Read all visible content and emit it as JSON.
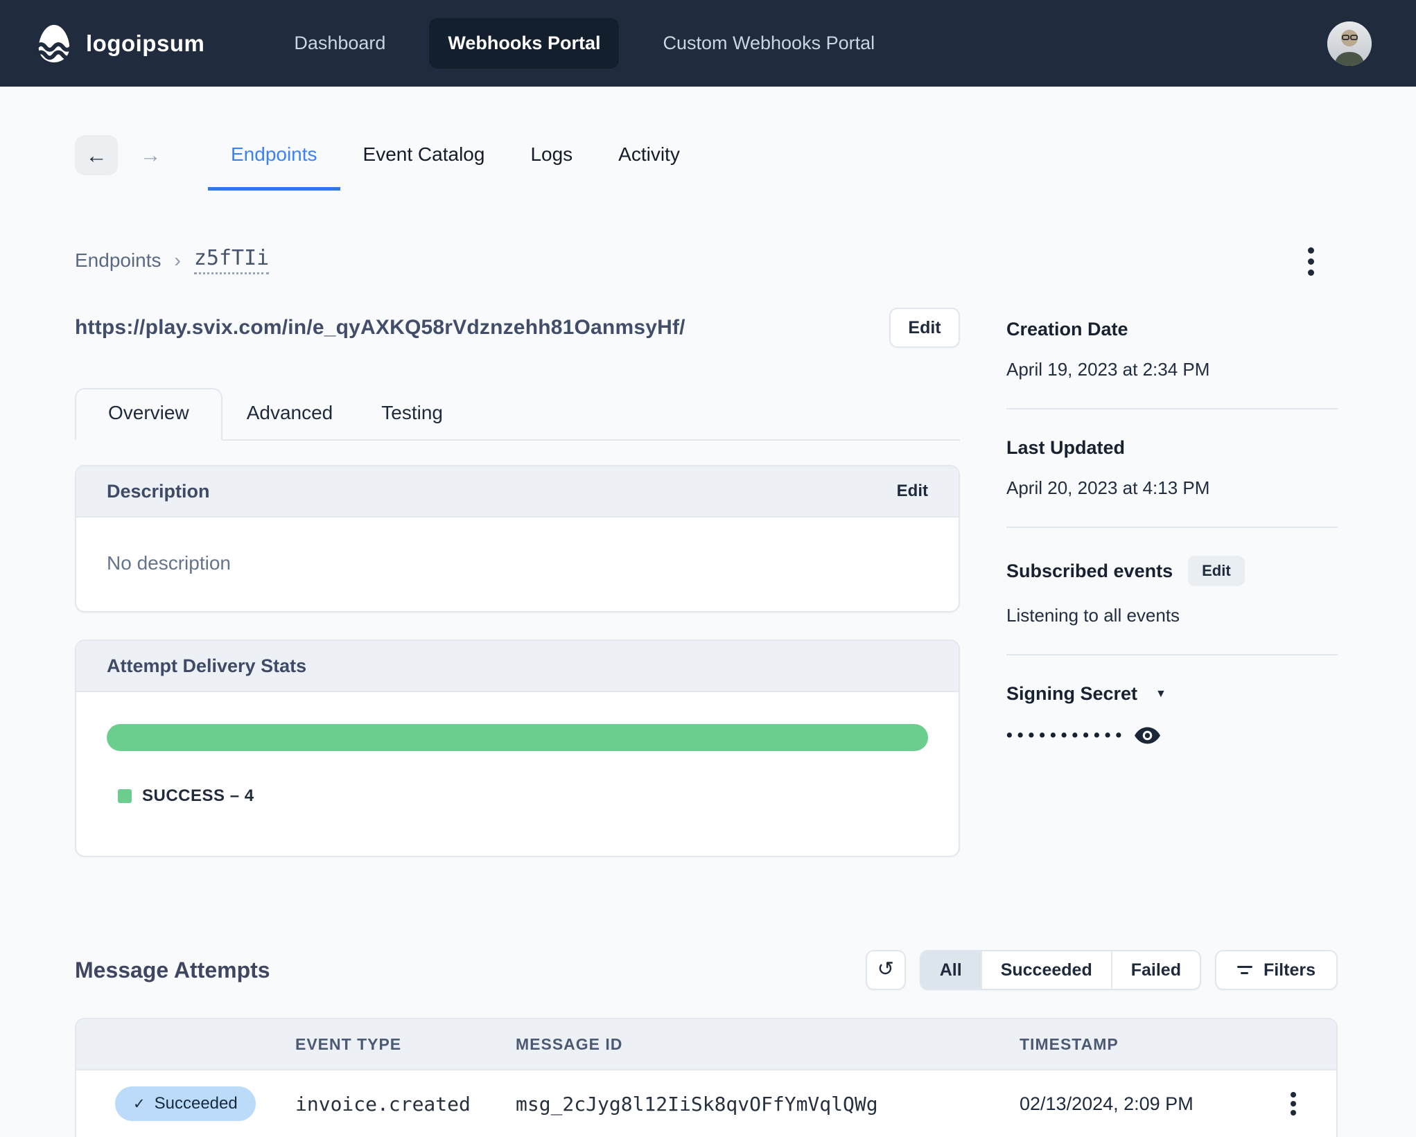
{
  "colors": {
    "nav_bg": "#202c3d",
    "accent_blue": "#3b82f6",
    "success_green": "#6cce8e",
    "badge_blue_bg": "#bcdbf9",
    "page_bg": "#f8fafc"
  },
  "icons": {
    "back_arrow": "←",
    "forward_arrow": "→",
    "breadcrumb_chevron": "›",
    "dropdown_caret": "▼",
    "refresh": "↺",
    "check": "✓"
  },
  "nav": {
    "logo_text": "logoipsum",
    "items": [
      {
        "label": "Dashboard",
        "active": false
      },
      {
        "label": "Webhooks Portal",
        "active": true
      },
      {
        "label": "Custom Webhooks Portal",
        "active": false
      }
    ]
  },
  "page_tabs": [
    {
      "label": "Endpoints",
      "active": true
    },
    {
      "label": "Event Catalog",
      "active": false
    },
    {
      "label": "Logs",
      "active": false
    },
    {
      "label": "Activity",
      "active": false
    }
  ],
  "breadcrumb": {
    "root": "Endpoints",
    "current": "z5fTIi"
  },
  "endpoint": {
    "url": "https://play.svix.com/in/e_qyAXKQ58rVdznzehh81OanmsyHf/",
    "edit_label": "Edit"
  },
  "detail_tabs": [
    {
      "label": "Overview",
      "active": true
    },
    {
      "label": "Advanced",
      "active": false
    },
    {
      "label": "Testing",
      "active": false
    }
  ],
  "description_card": {
    "title": "Description",
    "edit_label": "Edit",
    "empty_text": "No description"
  },
  "stats_card": {
    "title": "Attempt Delivery Stats",
    "legend_label": "SUCCESS – 4",
    "success_count": 4,
    "bar_percent": 100,
    "bar_color": "#6cce8e"
  },
  "sidebar": {
    "creation_date": {
      "label": "Creation Date",
      "value": "April 19, 2023 at 2:34 PM"
    },
    "last_updated": {
      "label": "Last Updated",
      "value": "April 20, 2023 at 4:13 PM"
    },
    "subscribed_events": {
      "label": "Subscribed events",
      "edit_label": "Edit",
      "value": "Listening to all events"
    },
    "signing_secret": {
      "label": "Signing Secret",
      "masked_value": "•••••••••••"
    }
  },
  "message_attempts": {
    "title": "Message Attempts",
    "filter_tabs": [
      {
        "label": "All",
        "active": true
      },
      {
        "label": "Succeeded",
        "active": false
      },
      {
        "label": "Failed",
        "active": false
      }
    ],
    "filters_label": "Filters",
    "table": {
      "headers": [
        "EVENT TYPE",
        "MESSAGE ID",
        "TIMESTAMP"
      ],
      "rows": [
        {
          "status": "Succeeded",
          "event_type": "invoice.created",
          "message_id": "msg_2cJyg8l12IiSk8qvOFfYmVqlQWg",
          "timestamp": "02/13/2024, 2:09 PM"
        }
      ]
    }
  }
}
